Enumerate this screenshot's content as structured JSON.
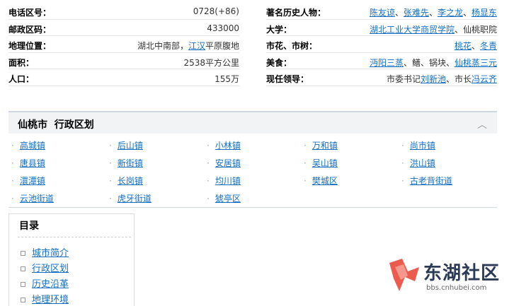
{
  "infobox": {
    "left": [
      {
        "label": "电话区号：",
        "value": "0728(+86)"
      },
      {
        "label": "邮政区码：",
        "value": "433000"
      },
      {
        "label": "地理位置：",
        "value_pre": "湖北中南部，",
        "value_link": "江汉",
        "value_post": "平原腹地"
      },
      {
        "label": "面积：",
        "value": "2538平方公里"
      },
      {
        "label": "人口：",
        "value": "155万"
      }
    ],
    "right": [
      {
        "label": "著名历史人物：",
        "links": [
          "陈友谅",
          "张难先",
          "李之龙",
          "杨显东"
        ],
        "sep": "、"
      },
      {
        "label": "大学：",
        "link1": "湖北工业大学商贸学院",
        "text1": "、仙桃职院"
      },
      {
        "label": "市花、市树：",
        "link1": "桃花",
        "text1": "、",
        "link2": "冬青"
      },
      {
        "label": "美食：",
        "link1": "沔阳三蒸",
        "text1": "、鳝、锅块、",
        "link2": "仙桃蒸三元"
      },
      {
        "label": "现任领导：",
        "text0": "市委书记",
        "link1": "刘新池",
        "text1": "、市长",
        "link2": "冯云齐"
      }
    ]
  },
  "admin": {
    "title": "仙桃市  行政区划",
    "chevron": "︿",
    "bullet": "·",
    "rows": [
      [
        "高城镇",
        "后山镇",
        "小林镇",
        "万和镇",
        "尚市镇"
      ],
      [
        "唐县镇",
        "新街镇",
        "安居镇",
        "吴山镇",
        "洪山镇"
      ],
      [
        "澴潭镇",
        "长岗镇",
        "均川镇",
        "樊城区",
        "古老背街道"
      ],
      [
        "云池街道",
        "虎牙街道",
        "猇亭区"
      ]
    ]
  },
  "toc": {
    "title": "目录",
    "items": [
      "城市简介",
      "行政区划",
      "历史沿革",
      "地理环境"
    ]
  },
  "watermark": {
    "name": "东湖社区",
    "url": "bbs.cnhubei.com",
    "color": "#e94a3c"
  }
}
